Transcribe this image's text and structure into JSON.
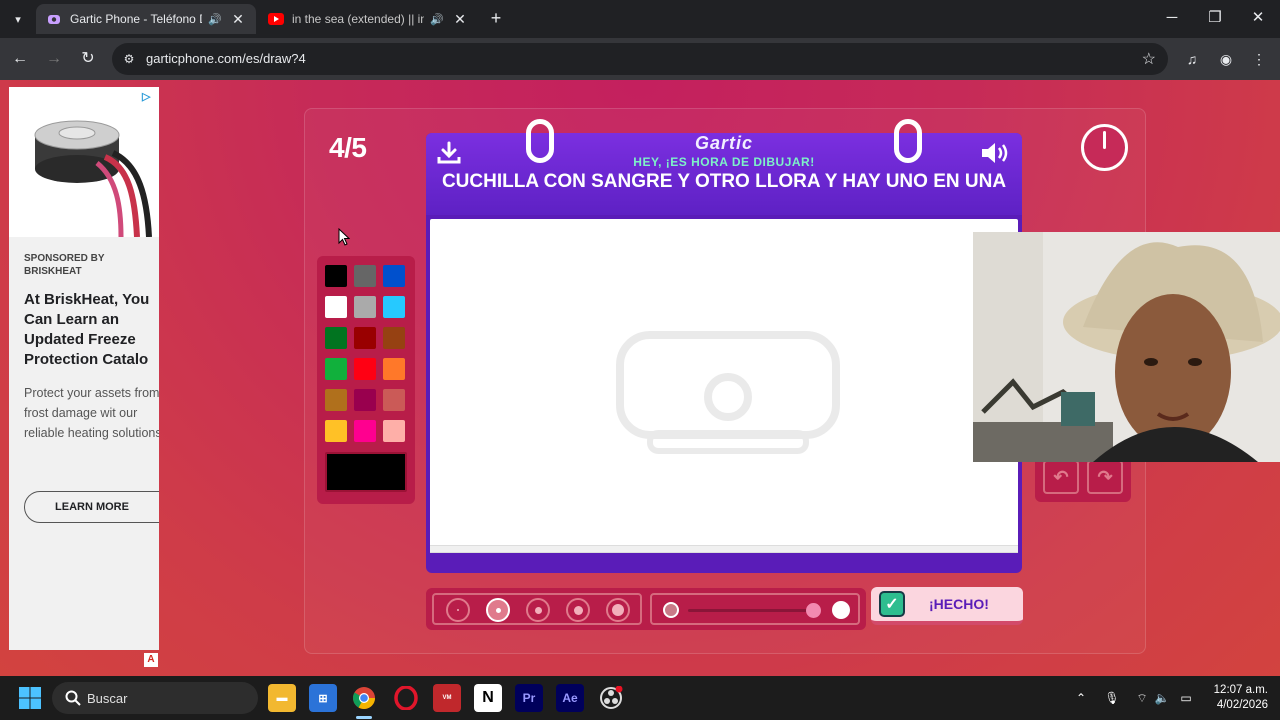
{
  "browser": {
    "tabs": [
      {
        "title": "Gartic Phone - Teléfono De",
        "active": true
      },
      {
        "title": "in the sea (extended) || in th",
        "active": false
      }
    ],
    "url": "garticphone.com/es/draw?4"
  },
  "ad": {
    "sponsor": "SPONSORED BY BRISKHEAT",
    "headline": "At BriskHeat, You Can Learn an Updated Freeze Protection Catalo",
    "body": "Protect your assets from frost damage wit our reliable heating solutions.",
    "cta": "LEARN MORE",
    "badge": "A"
  },
  "game": {
    "round": "4/5",
    "logo": "Gartic",
    "subtitle": "HEY, ¡ES HORA DE DIBUJAR!",
    "prompt": "CUCHILLA CON SANGRE Y OTRO LLORA Y HAY UNO EN UNA",
    "done_label": "¡HECHO!",
    "palette": [
      "#000000",
      "#666666",
      "#0050cd",
      "#ffffff",
      "#aaaaaa",
      "#26c9ff",
      "#017420",
      "#990000",
      "#964112",
      "#11b03c",
      "#ff0013",
      "#ff7829",
      "#b0701c",
      "#99004e",
      "#cb5a57",
      "#ffc126",
      "#ff008f",
      "#feafa8"
    ],
    "selected_color": "#000000",
    "brush_sizes": 5,
    "selected_brush": 2,
    "opacity": 1.0
  },
  "taskbar": {
    "search_placeholder": "Buscar",
    "time": "12:07 a.m.",
    "date": "4/02/2026"
  }
}
